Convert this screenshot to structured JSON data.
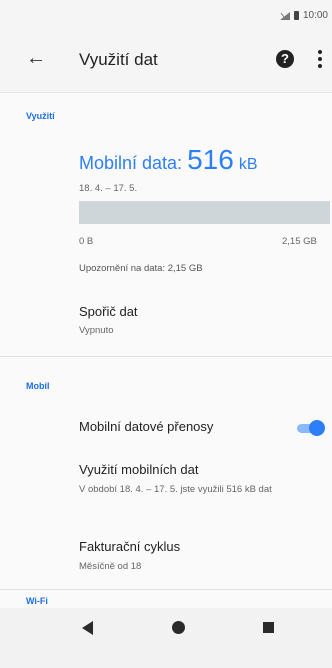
{
  "status_bar": {
    "time": "10:00",
    "signal_icon": "signal-icon",
    "battery_icon": "battery-icon"
  },
  "toolbar": {
    "title": "Využití dat",
    "back_icon": "arrow-left-icon",
    "help_icon": "help-icon",
    "menu_icon": "more-vert-icon"
  },
  "sections": {
    "usage": {
      "header": "Využití",
      "mobile_data_label": "Mobilní data:",
      "mobile_data_value": "516",
      "mobile_data_unit": "kB",
      "period": "18. 4. – 17. 5.",
      "usage_fraction": 0.0,
      "bar_min_label": "0 B",
      "bar_max_label": "2,15 GB",
      "warning": "Upozornění na data: 2,15 GB",
      "saver_title": "Spořič dat",
      "saver_status": "Vypnuto"
    },
    "mobile": {
      "header": "Mobil",
      "transfer_label": "Mobilní datové přenosy",
      "transfer_enabled": true,
      "usage_title": "Využití mobilních dat",
      "usage_desc": "V období 18. 4. – 17. 5. jste využili 516 kB dat",
      "billing_title": "Fakturační cyklus",
      "billing_desc": "Měsíčně od 18"
    },
    "wifi": {
      "header": "Wi-Fi"
    }
  },
  "colors": {
    "accent": "#2d7ff9",
    "bar_track": "#cfd6d9"
  },
  "nav": {
    "back_icon": "nav-back-icon",
    "home_icon": "nav-home-icon",
    "recents_icon": "nav-recents-icon"
  }
}
